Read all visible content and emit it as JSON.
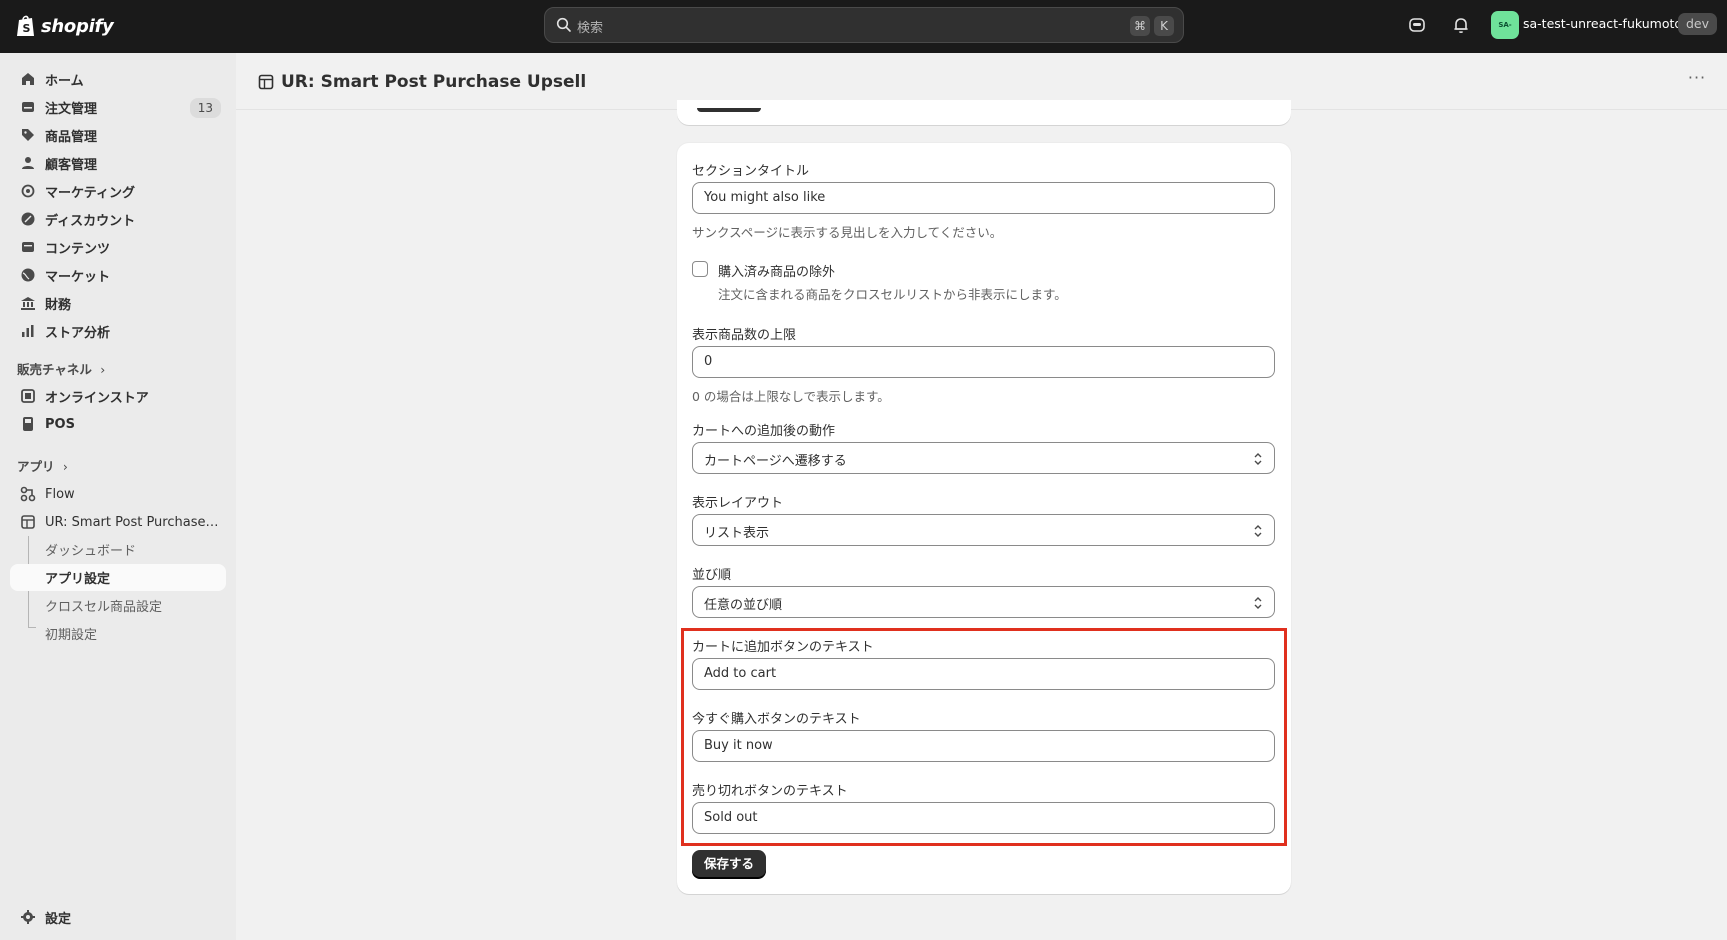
{
  "topbar": {
    "logo_text": "shopify",
    "search_placeholder": "検索",
    "search_shortcut_1": "⌘",
    "search_shortcut_2": "K",
    "store_avatar": "SA-",
    "store_name": "sa-test-unreact-fukumoto",
    "store_badge": "dev"
  },
  "sidebar": {
    "items": [
      {
        "label": "ホーム",
        "icon": "home-icon"
      },
      {
        "label": "注文管理",
        "icon": "orders-icon",
        "badge": "13"
      },
      {
        "label": "商品管理",
        "icon": "tag-icon"
      },
      {
        "label": "顧客管理",
        "icon": "person-icon"
      },
      {
        "label": "マーケティング",
        "icon": "target-icon"
      },
      {
        "label": "ディスカウント",
        "icon": "discount-icon"
      },
      {
        "label": "コンテンツ",
        "icon": "content-icon"
      },
      {
        "label": "マーケット",
        "icon": "globe-icon"
      },
      {
        "label": "財務",
        "icon": "bank-icon"
      },
      {
        "label": "ストア分析",
        "icon": "chart-icon"
      }
    ],
    "sales_channels_heading": "販売チャネル",
    "sales_channels": [
      {
        "label": "オンラインストア",
        "icon": "store-icon"
      },
      {
        "label": "POS",
        "icon": "pos-icon"
      }
    ],
    "apps_heading": "アプリ",
    "apps": [
      {
        "label": "Flow",
        "icon": "flow-icon"
      },
      {
        "label": "UR: Smart Post Purchase Upsell",
        "icon": "app-icon"
      }
    ],
    "app_subitems": [
      {
        "label": "ダッシュボード"
      },
      {
        "label": "アプリ設定"
      },
      {
        "label": "クロスセル商品設定"
      },
      {
        "label": "初期設定"
      }
    ],
    "settings_label": "設定"
  },
  "page": {
    "title": "UR: Smart Post Purchase Upsell"
  },
  "form": {
    "section_title_label": "セクションタイトル",
    "section_title_value": "You might also like",
    "section_title_help": "サンクスページに表示する見出しを入力してください。",
    "exclude_label": "購入済み商品の除外",
    "exclude_help": "注文に含まれる商品をクロスセルリストから非表示にします。",
    "exclude_checked": false,
    "max_items_label": "表示商品数の上限",
    "max_items_value": "0",
    "max_items_help": "0 の場合は上限なしで表示します。",
    "after_add_label": "カートへの追加後の動作",
    "after_add_value": "カートページへ遷移する",
    "layout_label": "表示レイアウト",
    "layout_value": "リスト表示",
    "sort_label": "並び順",
    "sort_value": "任意の並び順",
    "add_to_cart_label": "カートに追加ボタンのテキスト",
    "add_to_cart_value": "Add to cart",
    "buy_now_label": "今すぐ購入ボタンのテキスト",
    "buy_now_value": "Buy it now",
    "sold_out_label": "売り切れボタンのテキスト",
    "sold_out_value": "Sold out",
    "save_label": "保存する"
  },
  "colors": {
    "topbar": "#1a1a1a",
    "highlight": "#e0301e",
    "primary_button": "#303030",
    "avatar": "#6fe29a"
  }
}
